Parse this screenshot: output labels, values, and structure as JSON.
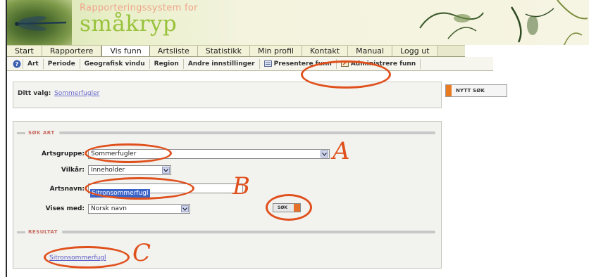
{
  "banner": {
    "subtitle": "Rapporteringssystem for",
    "title": "småkryp"
  },
  "menu": {
    "items": [
      {
        "label": "Start"
      },
      {
        "label": "Rapportere"
      },
      {
        "label": "Vis funn",
        "active": true
      },
      {
        "label": "Artsliste"
      },
      {
        "label": "Statistikk"
      },
      {
        "label": "Min profil"
      },
      {
        "label": "Kontakt"
      },
      {
        "label": "Manual"
      },
      {
        "label": "Logg ut"
      }
    ]
  },
  "submenu": {
    "help_icon": "help-icon",
    "items": [
      {
        "label": "Art"
      },
      {
        "label": "Periode"
      },
      {
        "label": "Geografisk vindu"
      },
      {
        "label": "Region"
      },
      {
        "label": "Andre innstillinger"
      },
      {
        "label": "Presentere funn",
        "icon": "present-icon"
      },
      {
        "label": "Administrere funn",
        "icon": "admin-icon"
      }
    ]
  },
  "choice": {
    "label": "Ditt valg:",
    "value": "Sommerfugler"
  },
  "new_search_button": {
    "label": "NYTT SØK"
  },
  "search": {
    "section_title": "SØK ART",
    "artsgruppe": {
      "label": "Artsgruppe:",
      "value": "Sommerfugler"
    },
    "vilkar": {
      "label": "Vilkår:",
      "value": "Inneholder"
    },
    "artsnavn": {
      "label": "Artsnavn:",
      "value": "Sitronsommerfugl"
    },
    "vises_med": {
      "label": "Vises med:",
      "value": "Norsk navn"
    },
    "search_button": "SØK"
  },
  "result": {
    "section_title": "RESULTAT",
    "link": "Sitronsommerfugl"
  },
  "annotations": {
    "a": "A",
    "b": "B",
    "c": "C"
  },
  "colors": {
    "annotation": "#e0501c",
    "brand_green": "#98c23c",
    "button_accent": "#e87a20",
    "link": "#5a5ac8"
  }
}
